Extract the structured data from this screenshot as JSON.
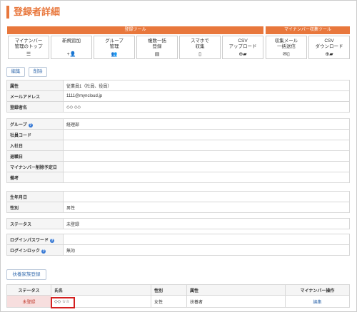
{
  "page": {
    "title": "登録者詳細"
  },
  "bars": {
    "registrant_tools": "登録ツール",
    "mynumber_tools": "マイナンバー収集ツール"
  },
  "tools": [
    {
      "label": "マイナンバー\n管理のトップ",
      "icon": "☰"
    },
    {
      "label": "新規追加",
      "icon": "+👤"
    },
    {
      "label": "グループ\n管理",
      "icon": "👥"
    },
    {
      "label": "複数一括\n登録",
      "icon": "▤"
    },
    {
      "label": "スマホで\n収集",
      "icon": "▯"
    },
    {
      "label": "CSV\nアップロード",
      "icon": "⊕▰"
    },
    {
      "label": "収集メール\n一括送信",
      "icon": "✉▯"
    },
    {
      "label": "CSV\nダウンロード",
      "icon": "⊕▰"
    }
  ],
  "actions": {
    "edit": "編集",
    "delete": "削除",
    "add_dependent": "扶養家族登録"
  },
  "basic": [
    {
      "label": "属性",
      "value": "従業員1（社員、役員）"
    },
    {
      "label": "メールアドレス",
      "value": "1111@myncloud.jp"
    },
    {
      "label": "登録者名",
      "value": "◇◇ ◇◇"
    }
  ],
  "org": [
    {
      "label": "グループ",
      "value": "経理部",
      "help": "?"
    },
    {
      "label": "社員コード",
      "value": ""
    },
    {
      "label": "入社日",
      "value": ""
    },
    {
      "label": "退職日",
      "value": ""
    },
    {
      "label": "マイナンバー削除予定日",
      "value": ""
    },
    {
      "label": "備考",
      "value": ""
    }
  ],
  "personal": [
    {
      "label": "生年月日",
      "value": ""
    },
    {
      "label": "性別",
      "value": "男性"
    }
  ],
  "status": {
    "label": "ステータス",
    "value": "未登録"
  },
  "login": [
    {
      "label": "ログインパスワード",
      "value": "",
      "help": "?"
    },
    {
      "label": "ログインロック",
      "value": "無効",
      "help": "?"
    }
  ],
  "family": {
    "headers": [
      "ステータス",
      "氏名",
      "性別",
      "属性",
      "マイナンバー操作"
    ],
    "rows": [
      {
        "status": "未登録",
        "name": "◇◇ ☆☆",
        "gender": "女性",
        "attr": "扶養者",
        "op": "編集"
      }
    ]
  }
}
